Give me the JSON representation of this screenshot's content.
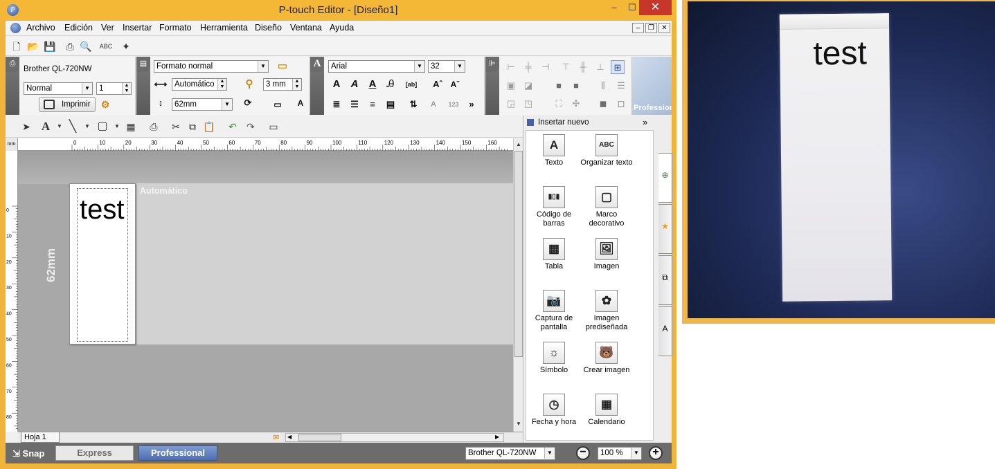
{
  "window": {
    "title": "P-touch Editor - [Diseño1]",
    "min": "‒",
    "max": "☐",
    "close": "✕"
  },
  "menu": [
    "Archivo",
    "Edición",
    "Ver",
    "Insertar",
    "Formato",
    "Herramienta",
    "Diseño",
    "Ventana",
    "Ayuda"
  ],
  "mdi": {
    "min": "–",
    "restore": "❐",
    "close": "✕"
  },
  "printer": {
    "name": "Brother QL-720NW",
    "quality": "Normal",
    "copies": "1",
    "print_label": "Imprimir"
  },
  "layout": {
    "format": "Formato normal",
    "length_mode": "Automático",
    "margin": "3 mm",
    "tape_width": "62mm"
  },
  "font": {
    "family": "Arial",
    "size": "32"
  },
  "banner": "Professional",
  "canvas": {
    "auto_label": "Automático",
    "label_text": "test",
    "width_tag": "62mm",
    "ruler_unit": "mm",
    "hruler_numbers": [
      "0",
      "10",
      "20",
      "30",
      "40",
      "50",
      "60",
      "70",
      "80",
      "90",
      "100",
      "110",
      "120",
      "130",
      "140",
      "150",
      "160"
    ],
    "vruler_numbers": [
      "0",
      "10",
      "20",
      "30",
      "40",
      "50",
      "60",
      "70",
      "80",
      "90"
    ]
  },
  "sheet": {
    "tab": "Hoja 1"
  },
  "panel": {
    "title": "Insertar nuevo",
    "items": [
      {
        "icon": "text-icon",
        "glyph": "A",
        "label": "Texto"
      },
      {
        "icon": "arrange-text-icon",
        "glyph": "ABC",
        "label": "Organizar texto"
      },
      {
        "icon": "barcode-icon",
        "glyph": "▮▯▮",
        "label": "Código de barras"
      },
      {
        "icon": "frame-icon",
        "glyph": "▢",
        "label": "Marco decorativo"
      },
      {
        "icon": "table-icon",
        "glyph": "▦",
        "label": "Tabla"
      },
      {
        "icon": "image-icon",
        "glyph": "🖼",
        "label": "Imagen"
      },
      {
        "icon": "screen-capture-icon",
        "glyph": "📷",
        "label": "Captura de pantalla"
      },
      {
        "icon": "clip-art-icon",
        "glyph": "✿",
        "label": "Imagen prediseñada"
      },
      {
        "icon": "symbol-icon",
        "glyph": "☼",
        "label": "Símbolo"
      },
      {
        "icon": "create-image-icon",
        "glyph": "🐻",
        "label": "Crear imagen"
      },
      {
        "icon": "date-time-icon",
        "glyph": "◷",
        "label": "Fecha y hora"
      },
      {
        "icon": "calendar-icon",
        "glyph": "▦",
        "label": "Calendario"
      }
    ]
  },
  "status": {
    "snap": "Snap",
    "express": "Express",
    "professional": "Professional",
    "printer": "Brother QL-720NW",
    "zoom": "100 %"
  },
  "photo": {
    "label_text": "test"
  }
}
